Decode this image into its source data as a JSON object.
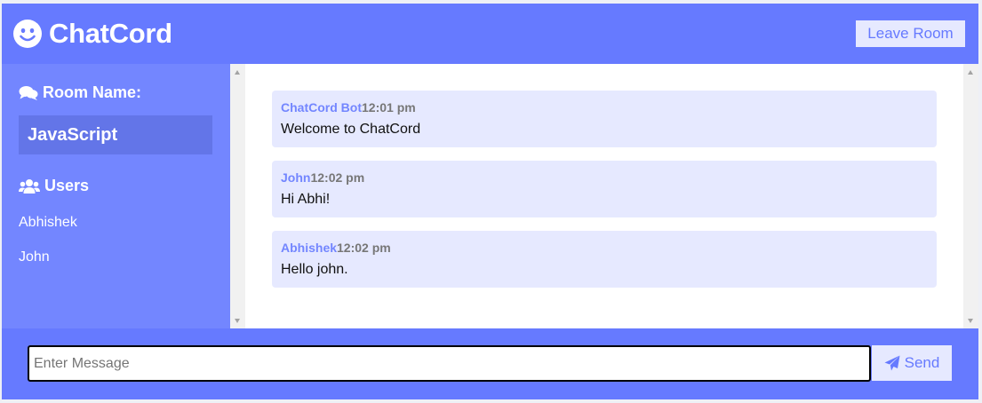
{
  "header": {
    "app_name": "ChatCord",
    "logo_icon": "smile-icon",
    "leave_label": "Leave Room"
  },
  "sidebar": {
    "room_heading": "Room Name:",
    "room_icon": "comments-icon",
    "room_name": "JavaScript",
    "users_heading": "Users",
    "users_icon": "users-icon",
    "users": [
      "Abhishek",
      "John"
    ]
  },
  "messages": [
    {
      "author": "ChatCord Bot",
      "time": "12:01 pm",
      "text": "Welcome to ChatCord"
    },
    {
      "author": "John",
      "time": "12:02 pm",
      "text": "Hi Abhi!"
    },
    {
      "author": "Abhishek",
      "time": "12:02 pm",
      "text": "Hello john."
    }
  ],
  "composer": {
    "placeholder": "Enter Message",
    "value": "",
    "send_label": "Send",
    "send_icon": "paper-plane-icon"
  },
  "colors": {
    "primary": "#667aff",
    "sidebar": "#7386ff",
    "light": "#e6e9ff"
  }
}
